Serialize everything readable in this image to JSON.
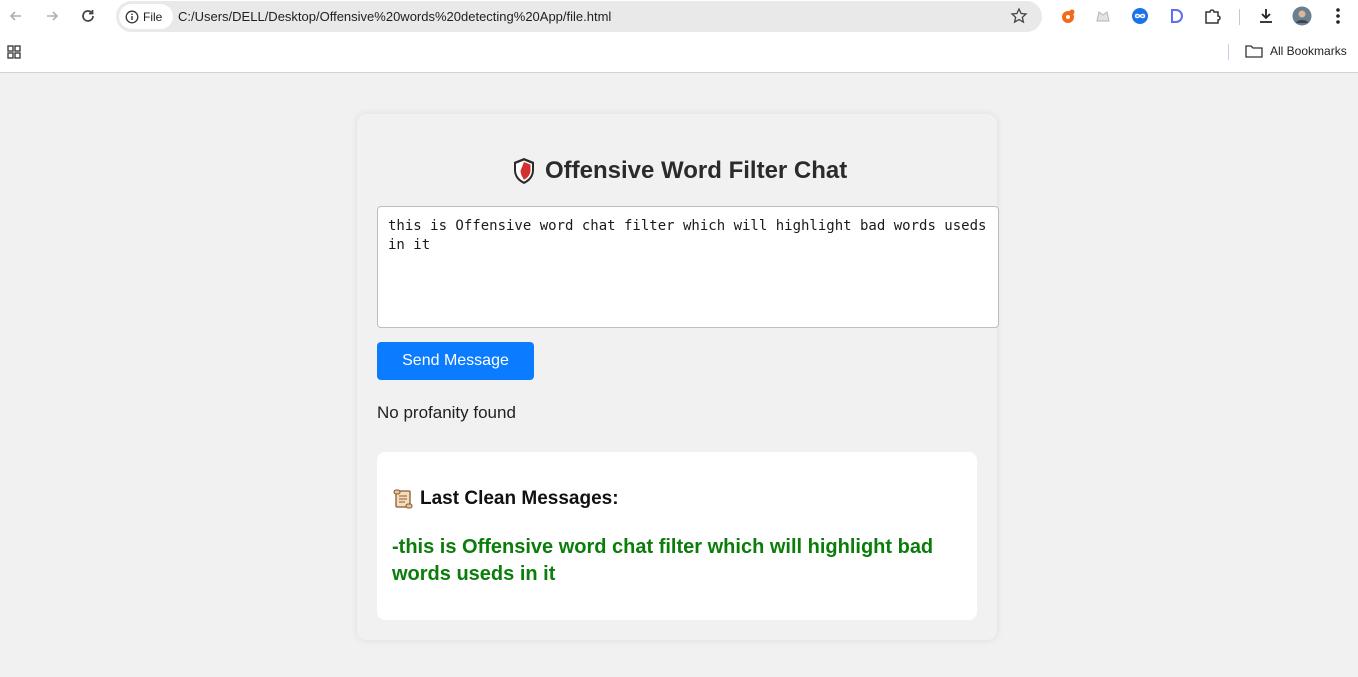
{
  "browser": {
    "scheme_label": "File",
    "url": "C:/Users/DELL/Desktop/Offensive%20words%20detecting%20App/file.html",
    "bookmarks_label": "All Bookmarks"
  },
  "page": {
    "title": "Offensive Word Filter Chat",
    "title_icon": "shield-icon",
    "input_value": "this is Offensive word chat filter which will highlight bad words useds in it",
    "send_label": "Send Message",
    "status_text": "No profanity found",
    "history_title": "Last Clean Messages:",
    "history_icon": "scroll-icon",
    "history_items": [
      "-this is Offensive word chat filter which will highlight bad words useds in it"
    ]
  },
  "colors": {
    "accent": "#0b7cff",
    "clean_message": "#0a7d0a",
    "shield": "#d32f2f"
  }
}
